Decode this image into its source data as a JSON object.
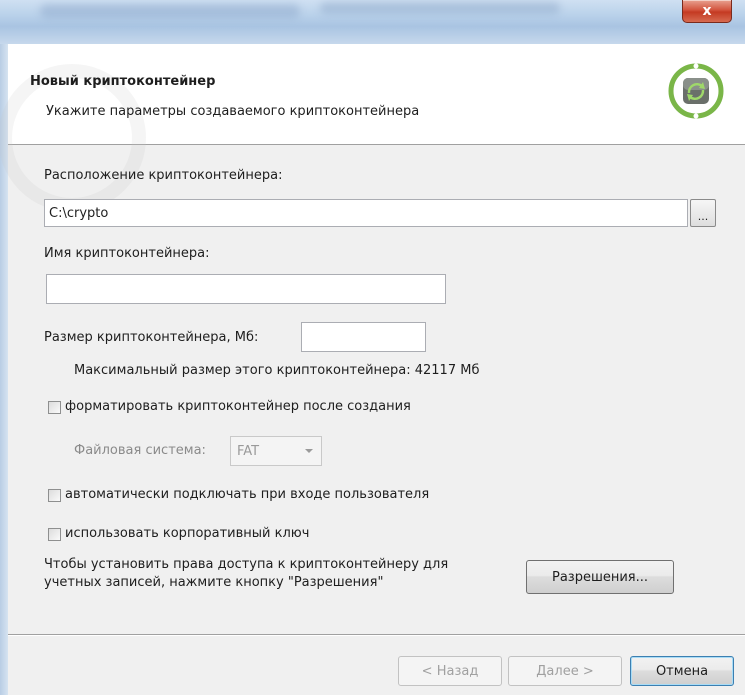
{
  "window": {
    "close_glyph": "x"
  },
  "header": {
    "title": "Новый криптоконтейнер",
    "subtitle": "Укажите параметры создаваемого криптоконтейнера",
    "logo_icon": "sync-arrows-icon"
  },
  "location": {
    "label": "Расположение криптоконтейнера:",
    "value": "C:\\crypto",
    "browse_label": "..."
  },
  "name": {
    "label": "Имя криптоконтейнера:",
    "value": ""
  },
  "size": {
    "label": "Размер криптоконтейнера, Мб:",
    "value": "",
    "max_text": "Максимальный размер этого криптоконтейнера: 42117 Мб"
  },
  "format": {
    "label": "форматировать криптоконтейнер после создания",
    "checked": false,
    "fs_label": "Файловая система:",
    "fs_value": "FAT"
  },
  "autoconnect": {
    "label": "автоматически подключать при входе пользователя",
    "checked": false
  },
  "corporate": {
    "label": "использовать корпоративный ключ",
    "checked": false
  },
  "permissions": {
    "text_line1": "Чтобы установить права доступа к криптоконтейнеру для",
    "text_line2": "учетных записей, нажмите кнопку \"Разрешения\"",
    "button_label": "Разрешения..."
  },
  "footer": {
    "back_label": "< Назад",
    "next_label": "Далее >",
    "cancel_label": "Отмена"
  },
  "colors": {
    "logo_green": "#7ab648",
    "close_red": "#c43a22",
    "default_button_border": "#3c7fb1"
  }
}
